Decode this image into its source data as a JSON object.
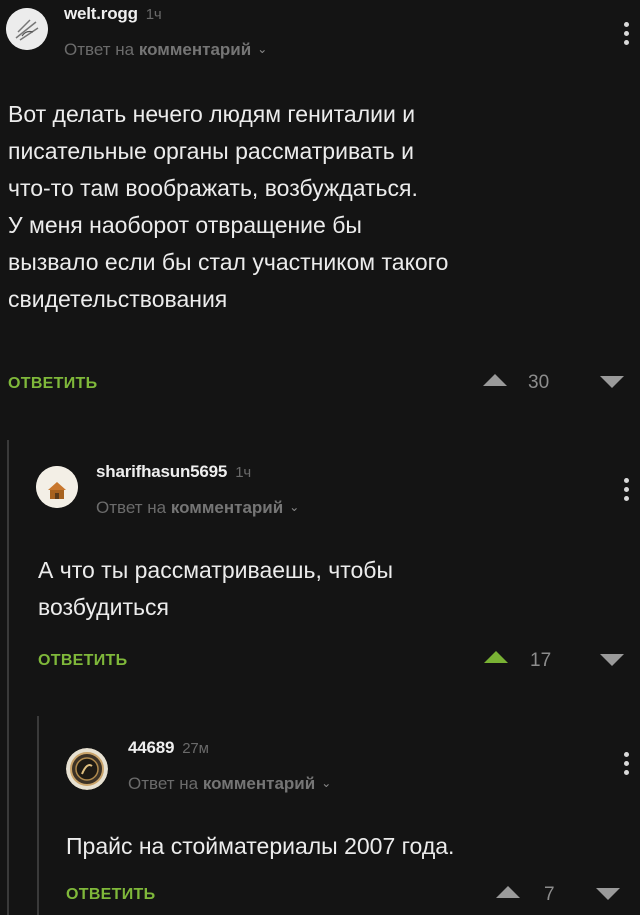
{
  "comments": [
    {
      "username": "welt.rogg",
      "time": "1ч",
      "reply_prefix": "Ответ на",
      "reply_target": "комментарий",
      "lines": [
        "Вот делать нечего людям гениталии и",
        "писательные органы рассматривать и",
        "что-то там воображать, возбуждаться.",
        "У меня наоборот отвращение бы",
        "вызвало если бы стал участником такого",
        "свидетельствования"
      ],
      "reply_label": "ОТВЕТИТЬ",
      "score": "30"
    },
    {
      "username": "sharifhasun5695",
      "time": "1ч",
      "reply_prefix": "Ответ на",
      "reply_target": "комментарий",
      "lines": [
        "А что ты рассматриваешь, чтобы",
        "возбудиться"
      ],
      "reply_label": "ОТВЕТИТЬ",
      "score": "17"
    },
    {
      "username": "44689",
      "time": "27м",
      "reply_prefix": "Ответ на",
      "reply_target": "комментарий",
      "lines": [
        "Прайс на стойматериалы 2007 года."
      ],
      "reply_label": "ОТВЕТИТЬ",
      "score": "7"
    }
  ],
  "colors": {
    "background": "#141414",
    "accent_green": "#7fb83a",
    "muted": "#6b6b6b"
  },
  "icons": {
    "more": "vertical-dots-icon",
    "upvote": "upvote-arrow-icon",
    "downvote": "downvote-arrow-icon",
    "chevron": "chevron-down-icon"
  }
}
